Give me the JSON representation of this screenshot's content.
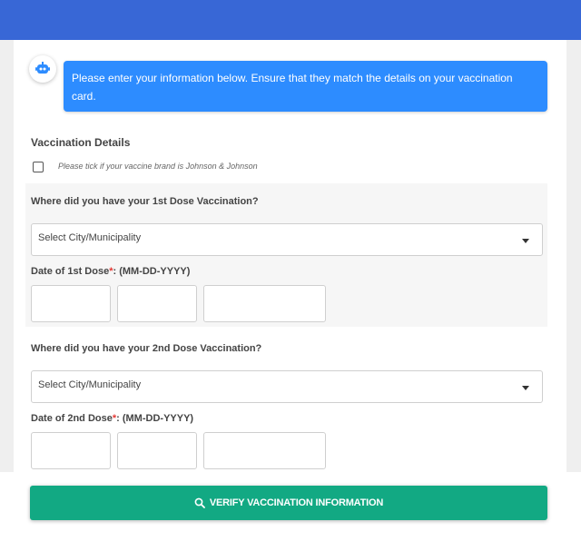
{
  "colors": {
    "header": "#3867d6",
    "bubble": "#2d8cff",
    "button": "#12a983",
    "required": "#e53935"
  },
  "chat": {
    "avatar_icon": "robot-icon",
    "message": "Please enter your information below. Ensure that they match the details on your vaccination card."
  },
  "vaccination": {
    "section_title": "Vaccination Details",
    "jj_checkbox_label": "Please tick if your vaccine brand is Johnson & Johnson",
    "jj_checked": false
  },
  "dose1": {
    "question": "Where did you have your 1st Dose Vaccination?",
    "select_value": "Select City/Municipality",
    "date_label": "Date of 1st Dose",
    "required_mark": "*",
    "date_format": ": (MM-DD-YYYY)"
  },
  "dose2": {
    "question": "Where did you have your 2nd Dose Vaccination?",
    "select_value": "Select City/Municipality",
    "date_label": "Date of 2nd Dose",
    "required_mark": "*",
    "date_format": ": (MM-DD-YYYY)"
  },
  "verify_button": {
    "icon": "search-icon",
    "label": "VERIFY VACCINATION INFORMATION"
  }
}
